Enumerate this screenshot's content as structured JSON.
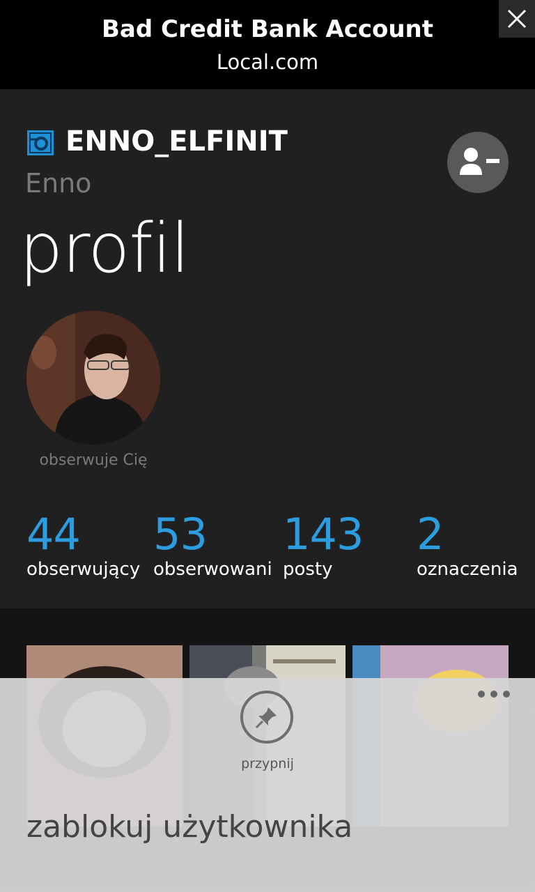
{
  "ad": {
    "title": "Bad Credit Bank Account",
    "subtitle": "Local.com"
  },
  "profile": {
    "username": "ENNO_ELFINIT",
    "full_name": "Enno",
    "page_title": "profil",
    "follow_status": "obserwuje Cię",
    "stats": [
      {
        "value": "44",
        "label": "obserwujący"
      },
      {
        "value": "53",
        "label": "obserwowani"
      },
      {
        "value": "143",
        "label": "posty"
      },
      {
        "value": "2",
        "label": "oznaczenia"
      }
    ]
  },
  "appbar": {
    "pin_label": "przypnij",
    "menu_items": [
      "zablokuj użytkownika"
    ]
  },
  "colors": {
    "accent": "#2b9de0",
    "background": "#202020",
    "appbar": "#d6d6d6"
  },
  "icons": [
    "close-icon",
    "instagram-icon",
    "unfollow-user-icon",
    "pin-icon",
    "more-icon"
  ]
}
